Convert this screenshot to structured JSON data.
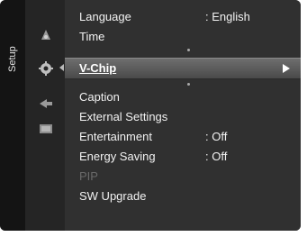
{
  "side_tab": "Setup",
  "menu": {
    "items": [
      {
        "label": "Language",
        "value": ": English"
      },
      {
        "label": "Time",
        "value": ""
      },
      {
        "label": "V-Chip",
        "value": ""
      },
      {
        "label": "Caption",
        "value": ""
      },
      {
        "label": "External Settings",
        "value": ""
      },
      {
        "label": "Entertainment",
        "value": ": Off"
      },
      {
        "label": "Energy Saving",
        "value": ": Off"
      },
      {
        "label": "PIP",
        "value": ""
      },
      {
        "label": "SW Upgrade",
        "value": ""
      }
    ],
    "selected_index": 2,
    "disabled_index": 7
  },
  "icons": [
    "picture-icon",
    "setup-gear-icon",
    "input-icon",
    "application-icon"
  ],
  "colors": {
    "background": "#303030",
    "selected": "#6e6e6e",
    "text": "#f2f2f2",
    "disabled": "#6a6a6a"
  }
}
